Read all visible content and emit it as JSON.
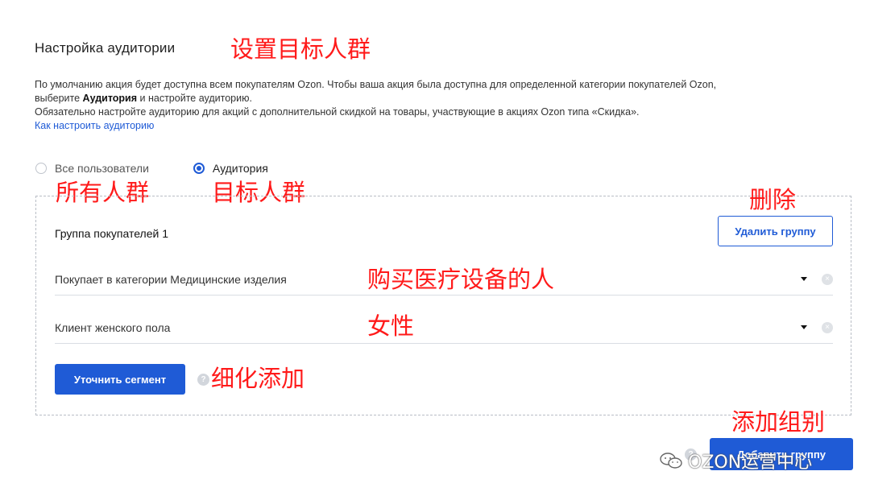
{
  "section": {
    "title": "Настройка аудитории",
    "description_line1": "По умолчанию акция будет доступна всем покупателям Ozon. Чтобы ваша акция была доступна для определенной категории покупателей Ozon,",
    "description_line2_pre": "выберите ",
    "description_line2_bold": "Аудитория",
    "description_line2_post": " и настройте аудиторию.",
    "description_line3": "Обязательно настройте аудиторию для акций с дополнительной скидкой на товары, участвующие в акциях Ozon типа «Скидка».",
    "help_link": "Как настроить аудиторию"
  },
  "audience_options": [
    {
      "label": "Все пользователи",
      "selected": false
    },
    {
      "label": "Аудитория",
      "selected": true
    }
  ],
  "group": {
    "title": "Группа покупателей 1",
    "delete_label": "Удалить группу",
    "conditions": [
      {
        "value": "Покупает в категории Медицинские изделия"
      },
      {
        "value": "Клиент женского пола"
      }
    ],
    "refine_label": "Уточнить сегмент",
    "help_glyph": "?"
  },
  "add_group": {
    "help_glyph": "?",
    "label": "Добавить группу"
  },
  "annotations": {
    "title": "设置目标人群",
    "all_users": "所有人群",
    "audience": "目标人群",
    "delete": "删除",
    "condition1": "购买医疗设备的人",
    "condition2": "女性",
    "refine": "细化添加",
    "add_group": "添加组别"
  },
  "watermark": {
    "text": "OZON运营中心",
    "icon": "wechat-icon"
  },
  "colors": {
    "accent": "#1f5bd6",
    "annotation": "#ff1a1a"
  }
}
